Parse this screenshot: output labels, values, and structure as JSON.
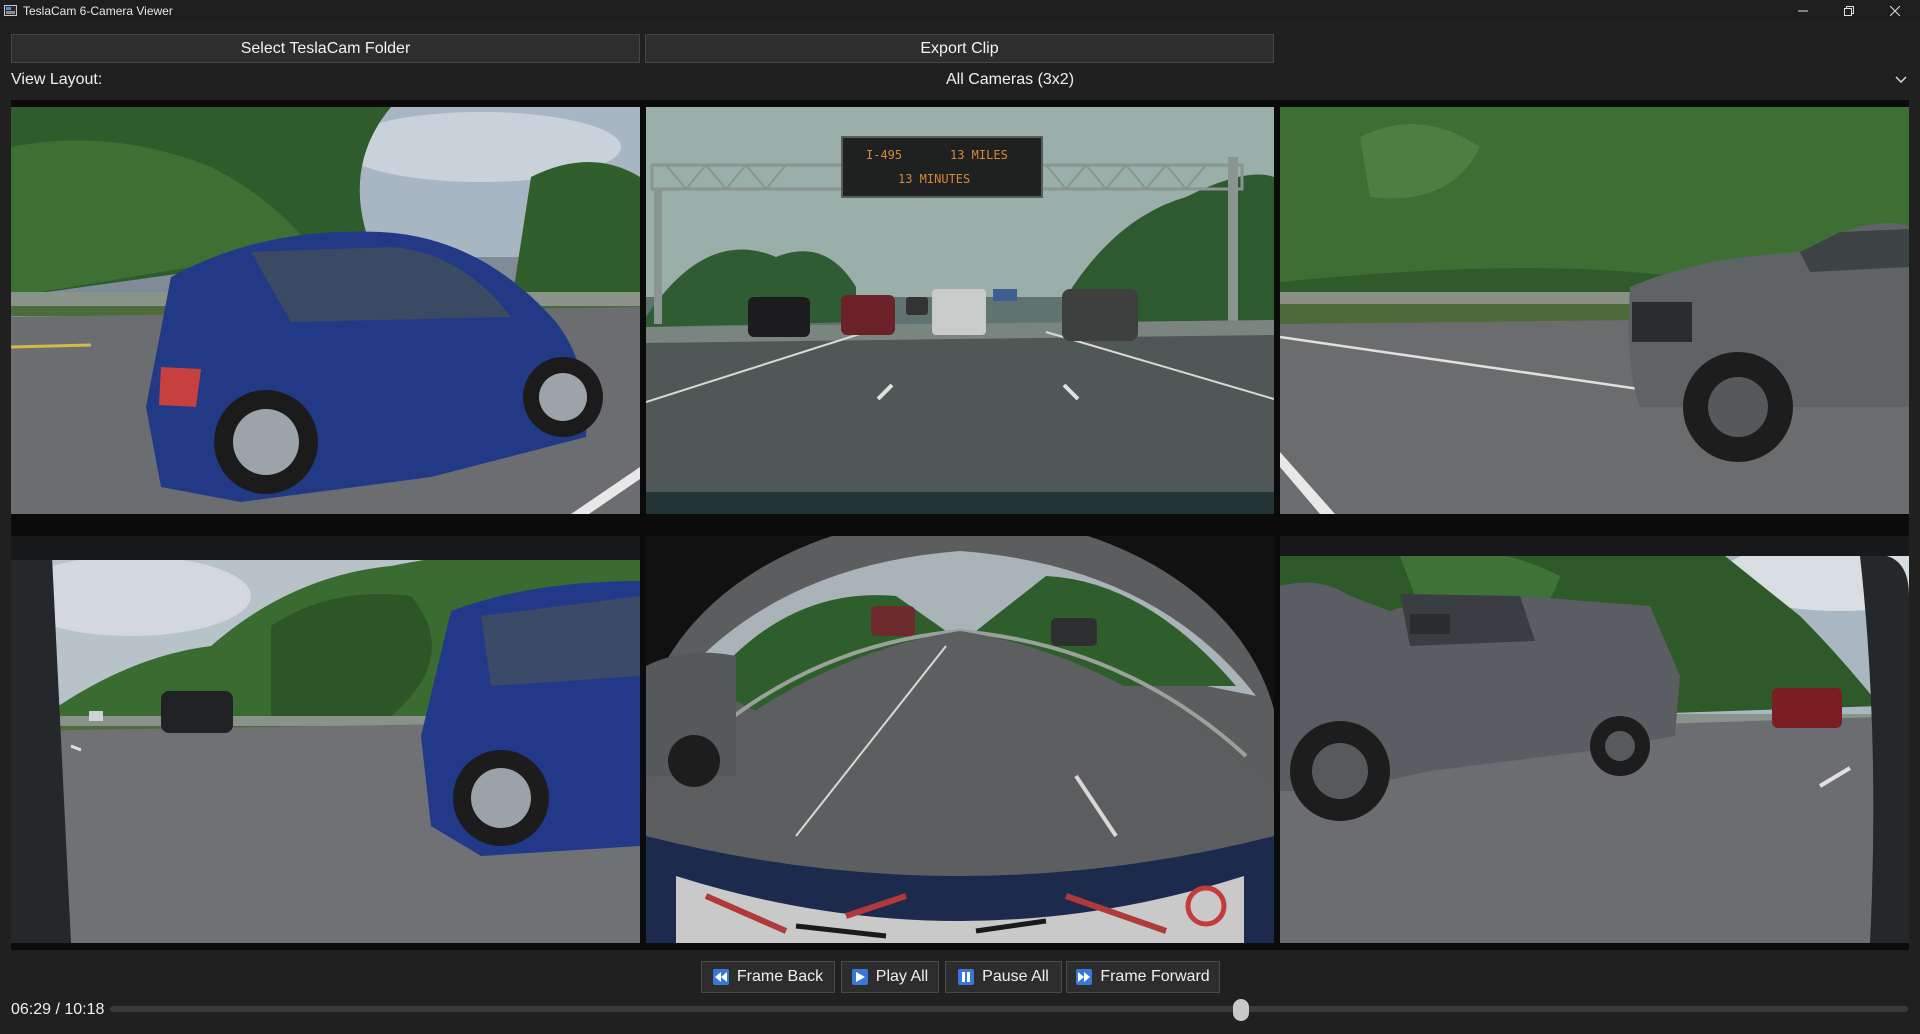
{
  "window": {
    "title": "TeslaCam 6-Camera Viewer"
  },
  "toolbar": {
    "select_folder": "Select TeslaCam Folder",
    "export_clip": "Export Clip"
  },
  "layout": {
    "label": "View Layout:",
    "selected": "All Cameras (3x2)"
  },
  "sign": {
    "line1_left": "I-495",
    "line1_right": "13 MILES",
    "line2": "13 MINUTES"
  },
  "controls": {
    "frame_back": "Frame Back",
    "play_all": "Play All",
    "pause_all": "Pause All",
    "frame_forward": "Frame Forward"
  },
  "playback": {
    "current": "06:29",
    "total": "10:18",
    "time_text": "06:29 / 10:18",
    "progress": 0.629
  },
  "colors": {
    "accent": "#3a78d8",
    "background": "#202020",
    "button": "#2e2e2e"
  }
}
